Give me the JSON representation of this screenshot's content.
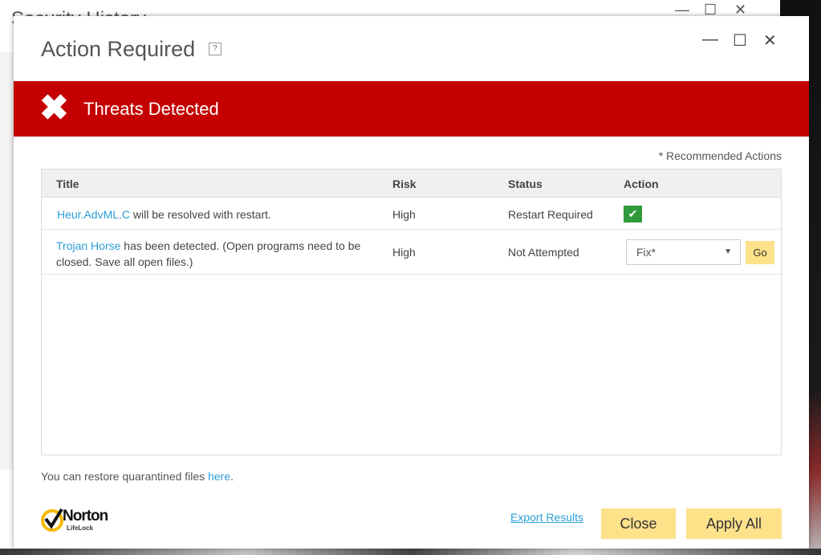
{
  "background_window": {
    "title": "Security History",
    "help": "?",
    "minimize": "—",
    "maximize": "☐",
    "close": "✕"
  },
  "dialog": {
    "title": "Action Required",
    "help": "?",
    "minimize": "—",
    "maximize": "☐",
    "close": "✕"
  },
  "banner": {
    "icon": "x-icon",
    "glyph": "✖",
    "text": "Threats Detected",
    "color": "#c40000"
  },
  "recommended_note": "* Recommended Actions",
  "table": {
    "headers": [
      "Title",
      "Risk",
      "Status",
      "Action"
    ],
    "rows": [
      {
        "threat": "Heur.AdvML.C",
        "desc": " will be resolved with restart.",
        "risk": "High",
        "status": "Restart Required",
        "action": "✔"
      },
      {
        "threat": "Trojan Horse",
        "desc": "  has been detected. (Open programs need to be closed. Save all open files.)",
        "risk": "High",
        "status": "Not Attempted",
        "action_select": "Fix*",
        "go": "Go"
      }
    ]
  },
  "restore": {
    "text": "You can restore quarantined files ",
    "link": "here",
    "end": "."
  },
  "logo": {
    "brand": "Norton",
    "sub": "LifeLock"
  },
  "footer": {
    "export": "Export Results",
    "close": "Close",
    "apply_all": "Apply All"
  }
}
